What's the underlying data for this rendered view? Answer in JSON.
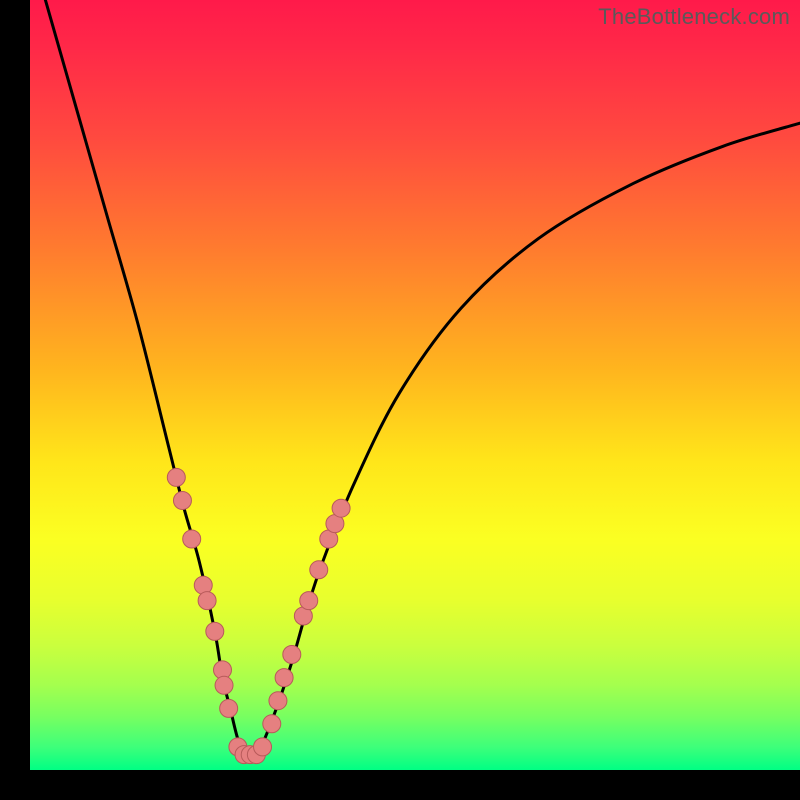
{
  "watermark": "TheBottleneck.com",
  "icon_names": {
    "dot": "data-point-icon"
  },
  "colors": {
    "curve": "#000000",
    "dot_fill": "#e58080",
    "dot_stroke": "#b85a5a",
    "gradient_top": "#ff1a4a",
    "gradient_bottom": "#00ff84"
  },
  "chart_data": {
    "type": "line",
    "title": "",
    "xlabel": "",
    "ylabel": "",
    "xlim": [
      0,
      100
    ],
    "ylim": [
      0,
      100
    ],
    "grid": false,
    "series": [
      {
        "name": "curve",
        "x": [
          2,
          6,
          10,
          14,
          18,
          20,
          22,
          24,
          25,
          26,
          27,
          28,
          29,
          30,
          32,
          34,
          36,
          38,
          42,
          48,
          56,
          66,
          78,
          90,
          100
        ],
        "y": [
          100,
          86,
          72,
          58,
          42,
          34,
          27,
          18,
          12,
          8,
          4,
          2,
          2,
          3,
          8,
          14,
          21,
          27,
          37,
          49,
          60,
          69,
          76,
          81,
          84
        ]
      }
    ],
    "points": [
      {
        "x": 19.0,
        "y": 38
      },
      {
        "x": 19.8,
        "y": 35
      },
      {
        "x": 21.0,
        "y": 30
      },
      {
        "x": 22.5,
        "y": 24
      },
      {
        "x": 23.0,
        "y": 22
      },
      {
        "x": 24.0,
        "y": 18
      },
      {
        "x": 25.0,
        "y": 13
      },
      {
        "x": 25.2,
        "y": 11
      },
      {
        "x": 25.8,
        "y": 8
      },
      {
        "x": 27.0,
        "y": 3
      },
      {
        "x": 27.8,
        "y": 2
      },
      {
        "x": 28.6,
        "y": 2
      },
      {
        "x": 29.4,
        "y": 2
      },
      {
        "x": 30.2,
        "y": 3
      },
      {
        "x": 31.4,
        "y": 6
      },
      {
        "x": 32.2,
        "y": 9
      },
      {
        "x": 33.0,
        "y": 12
      },
      {
        "x": 34.0,
        "y": 15
      },
      {
        "x": 35.5,
        "y": 20
      },
      {
        "x": 36.2,
        "y": 22
      },
      {
        "x": 37.5,
        "y": 26
      },
      {
        "x": 38.8,
        "y": 30
      },
      {
        "x": 39.6,
        "y": 32
      },
      {
        "x": 40.4,
        "y": 34
      }
    ]
  }
}
